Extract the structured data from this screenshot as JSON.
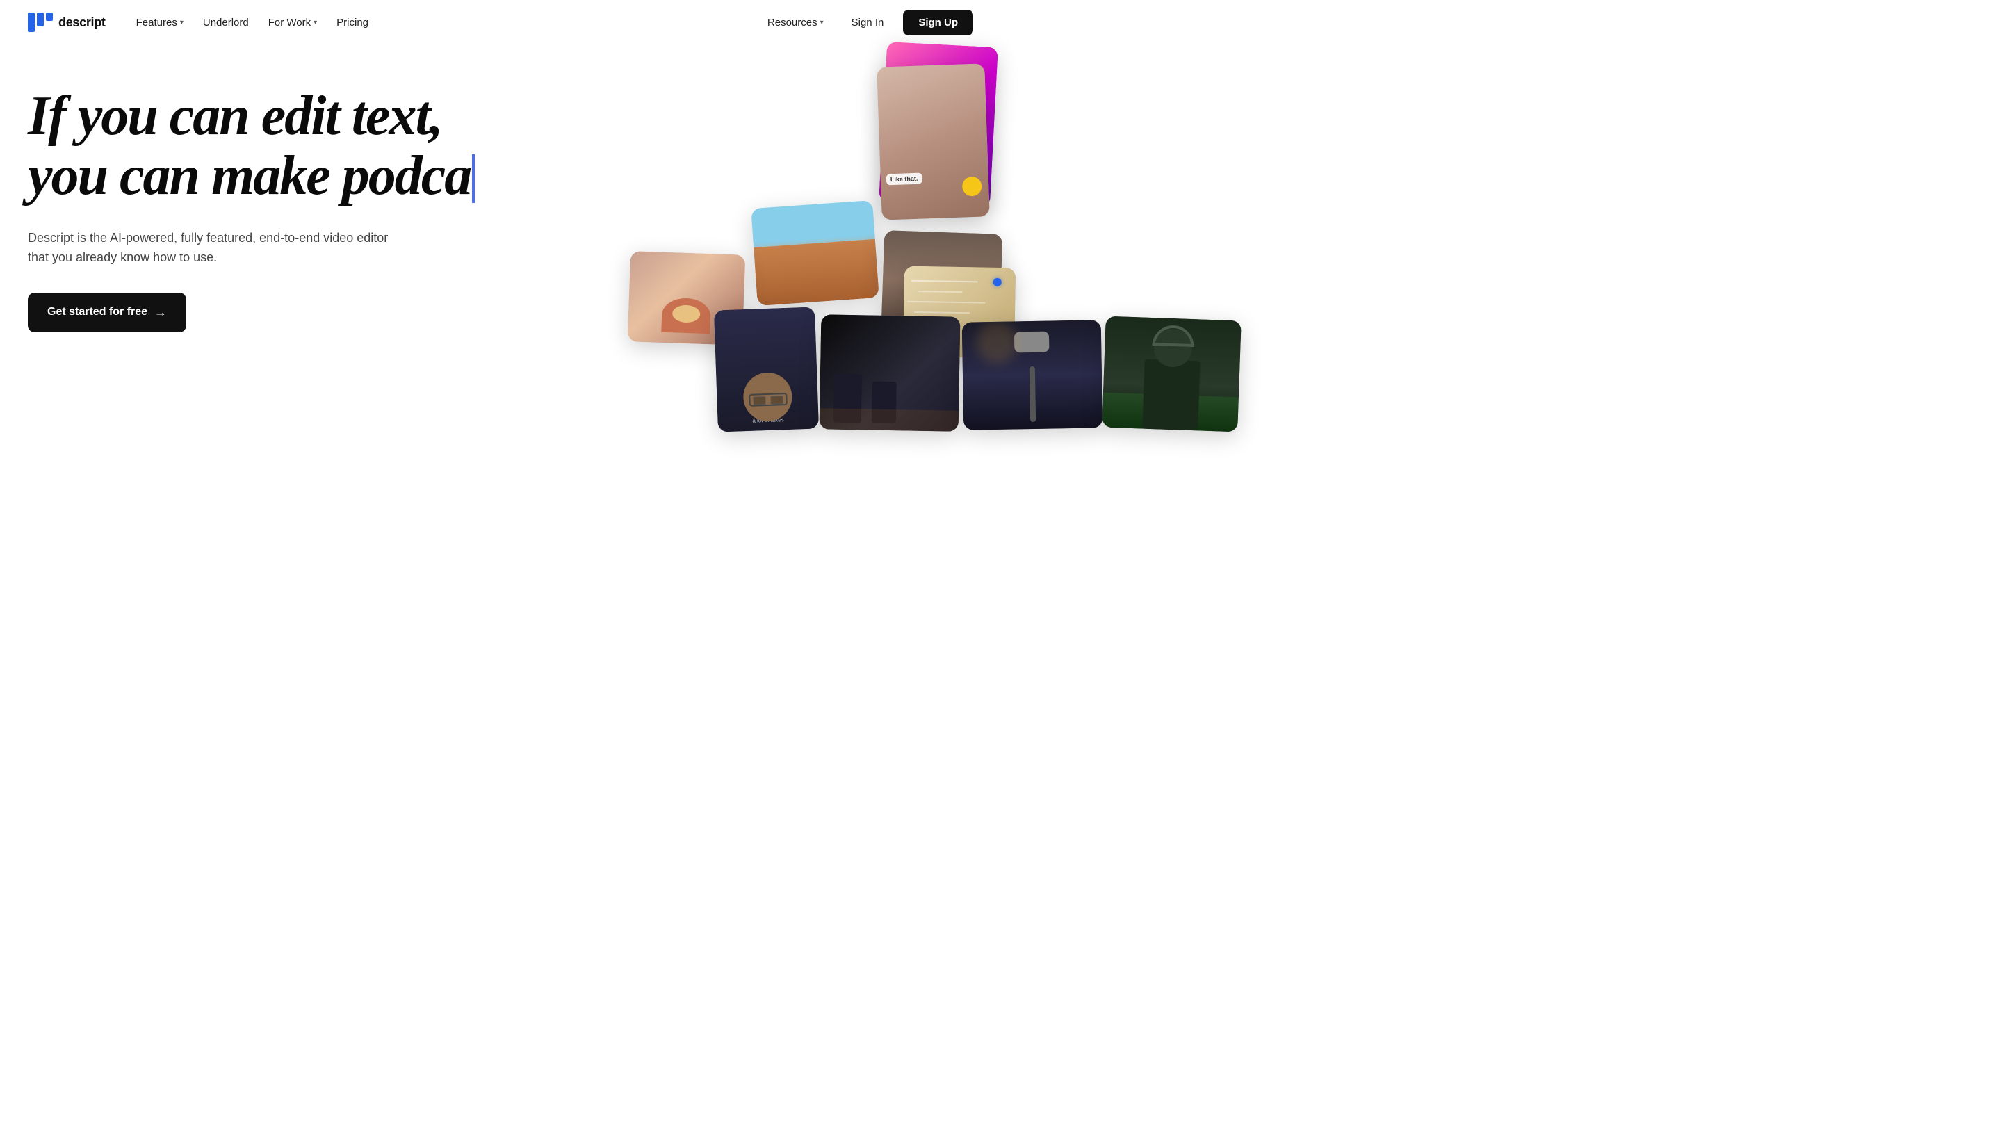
{
  "logo": {
    "text": "descript"
  },
  "nav": {
    "links": [
      {
        "label": "Features",
        "has_dropdown": true
      },
      {
        "label": "Underlord",
        "has_dropdown": false
      },
      {
        "label": "For Work",
        "has_dropdown": true
      },
      {
        "label": "Pricing",
        "has_dropdown": false
      }
    ],
    "right": {
      "resources_label": "Resources",
      "sign_in_label": "Sign In",
      "sign_up_label": "Sign Up"
    }
  },
  "hero": {
    "headline_line1": "If you can edit text,",
    "headline_line2": "you can make podca",
    "subtext": "Descript is the AI-powered, fully featured, end-to-end video editor that you already know how to use.",
    "cta_label": "Get started for free",
    "cta_arrow": "→"
  }
}
